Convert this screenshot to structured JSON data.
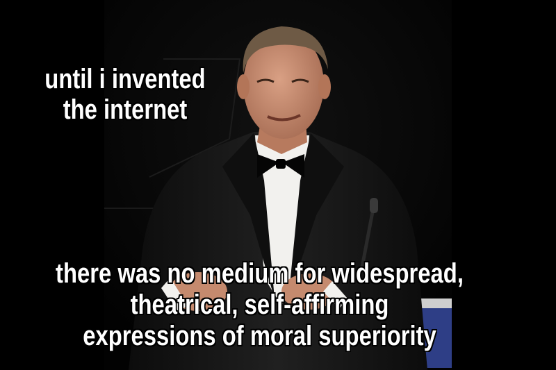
{
  "meme": {
    "top_caption": [
      "until i invented",
      "the internet"
    ],
    "bottom_caption": [
      "there was no medium for widespread,",
      "theatrical, self-affirming",
      "expressions of moral superiority"
    ]
  },
  "colors": {
    "background": "#000000",
    "caption_text": "#ffffff",
    "caption_outline": "#000000",
    "suit": "#1a1a1a",
    "shirt": "#f2f1ee",
    "skin": "#c98c6f",
    "hair": "#6e5a45",
    "podium_screen": "#2e3e86"
  }
}
